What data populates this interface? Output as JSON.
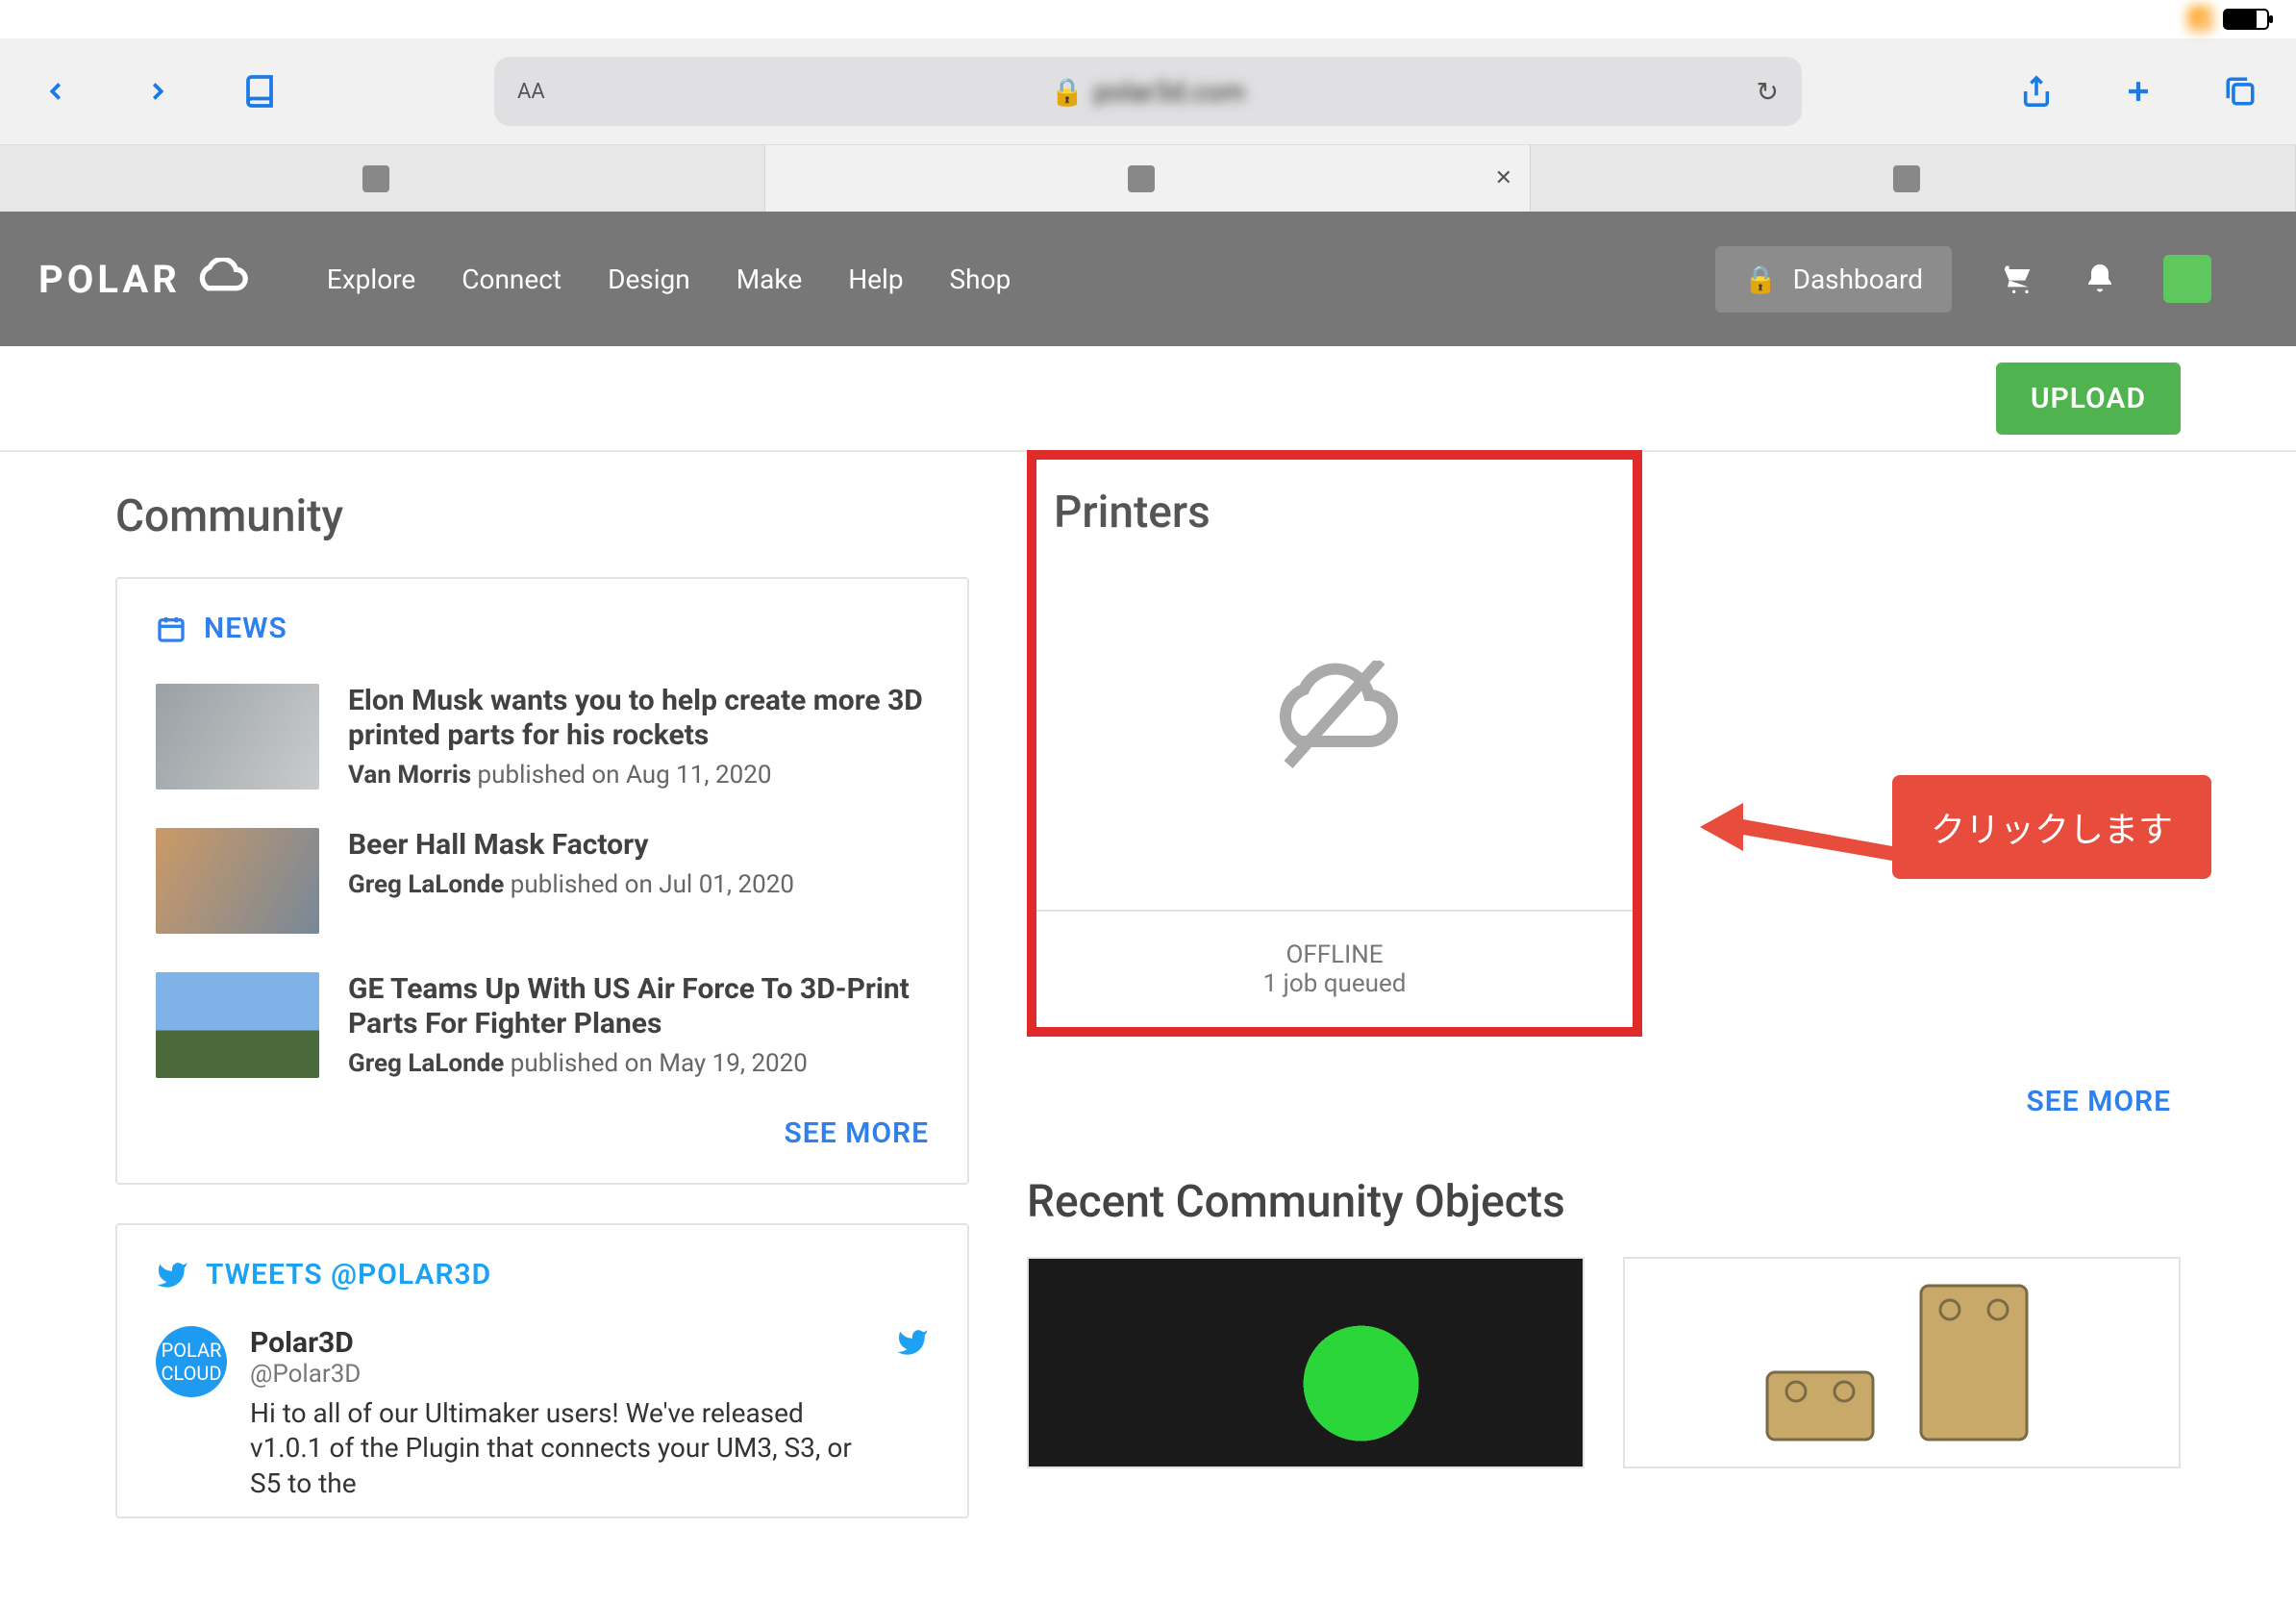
{
  "statusbar": {
    "time": ""
  },
  "safari": {
    "url_host": "polar3d.com"
  },
  "tabs": [
    {
      "label": ""
    },
    {
      "label": ""
    },
    {
      "label": ""
    }
  ],
  "polar_nav": {
    "brand": "POLAR",
    "links": [
      "Explore",
      "Connect",
      "Design",
      "Make",
      "Help",
      "Shop"
    ],
    "dashboard": "Dashboard",
    "username": ""
  },
  "subheader": {
    "crumbs": "",
    "upload": "UPLOAD"
  },
  "community": {
    "title": "Community",
    "news_header": "NEWS",
    "items": [
      {
        "title": "Elon Musk wants you to help create more 3D printed parts for his rockets",
        "author": "Van Morris",
        "published": "published on Aug 11, 2020"
      },
      {
        "title": "Beer Hall Mask Factory",
        "author": "Greg LaLonde",
        "published": "published on Jul 01, 2020"
      },
      {
        "title": "GE Teams Up With US Air Force To 3D-Print Parts For Fighter Planes",
        "author": "Greg LaLonde",
        "published": "published on May 19, 2020"
      }
    ],
    "see_more": "SEE MORE"
  },
  "tweets": {
    "header": "TWEETS @POLAR3D",
    "name": "Polar3D",
    "handle": "@Polar3D",
    "text": "Hi to all of our Ultimaker users! We've released v1.0.1 of the Plugin that connects your UM3, S3, or S5 to the"
  },
  "printers": {
    "title": "Printers",
    "name": "",
    "status": "OFFLINE",
    "jobs": "1 job queued",
    "see_more": "SEE MORE"
  },
  "annotation": {
    "bubble": "クリックします"
  },
  "recent": {
    "title": "Recent Community Objects"
  }
}
